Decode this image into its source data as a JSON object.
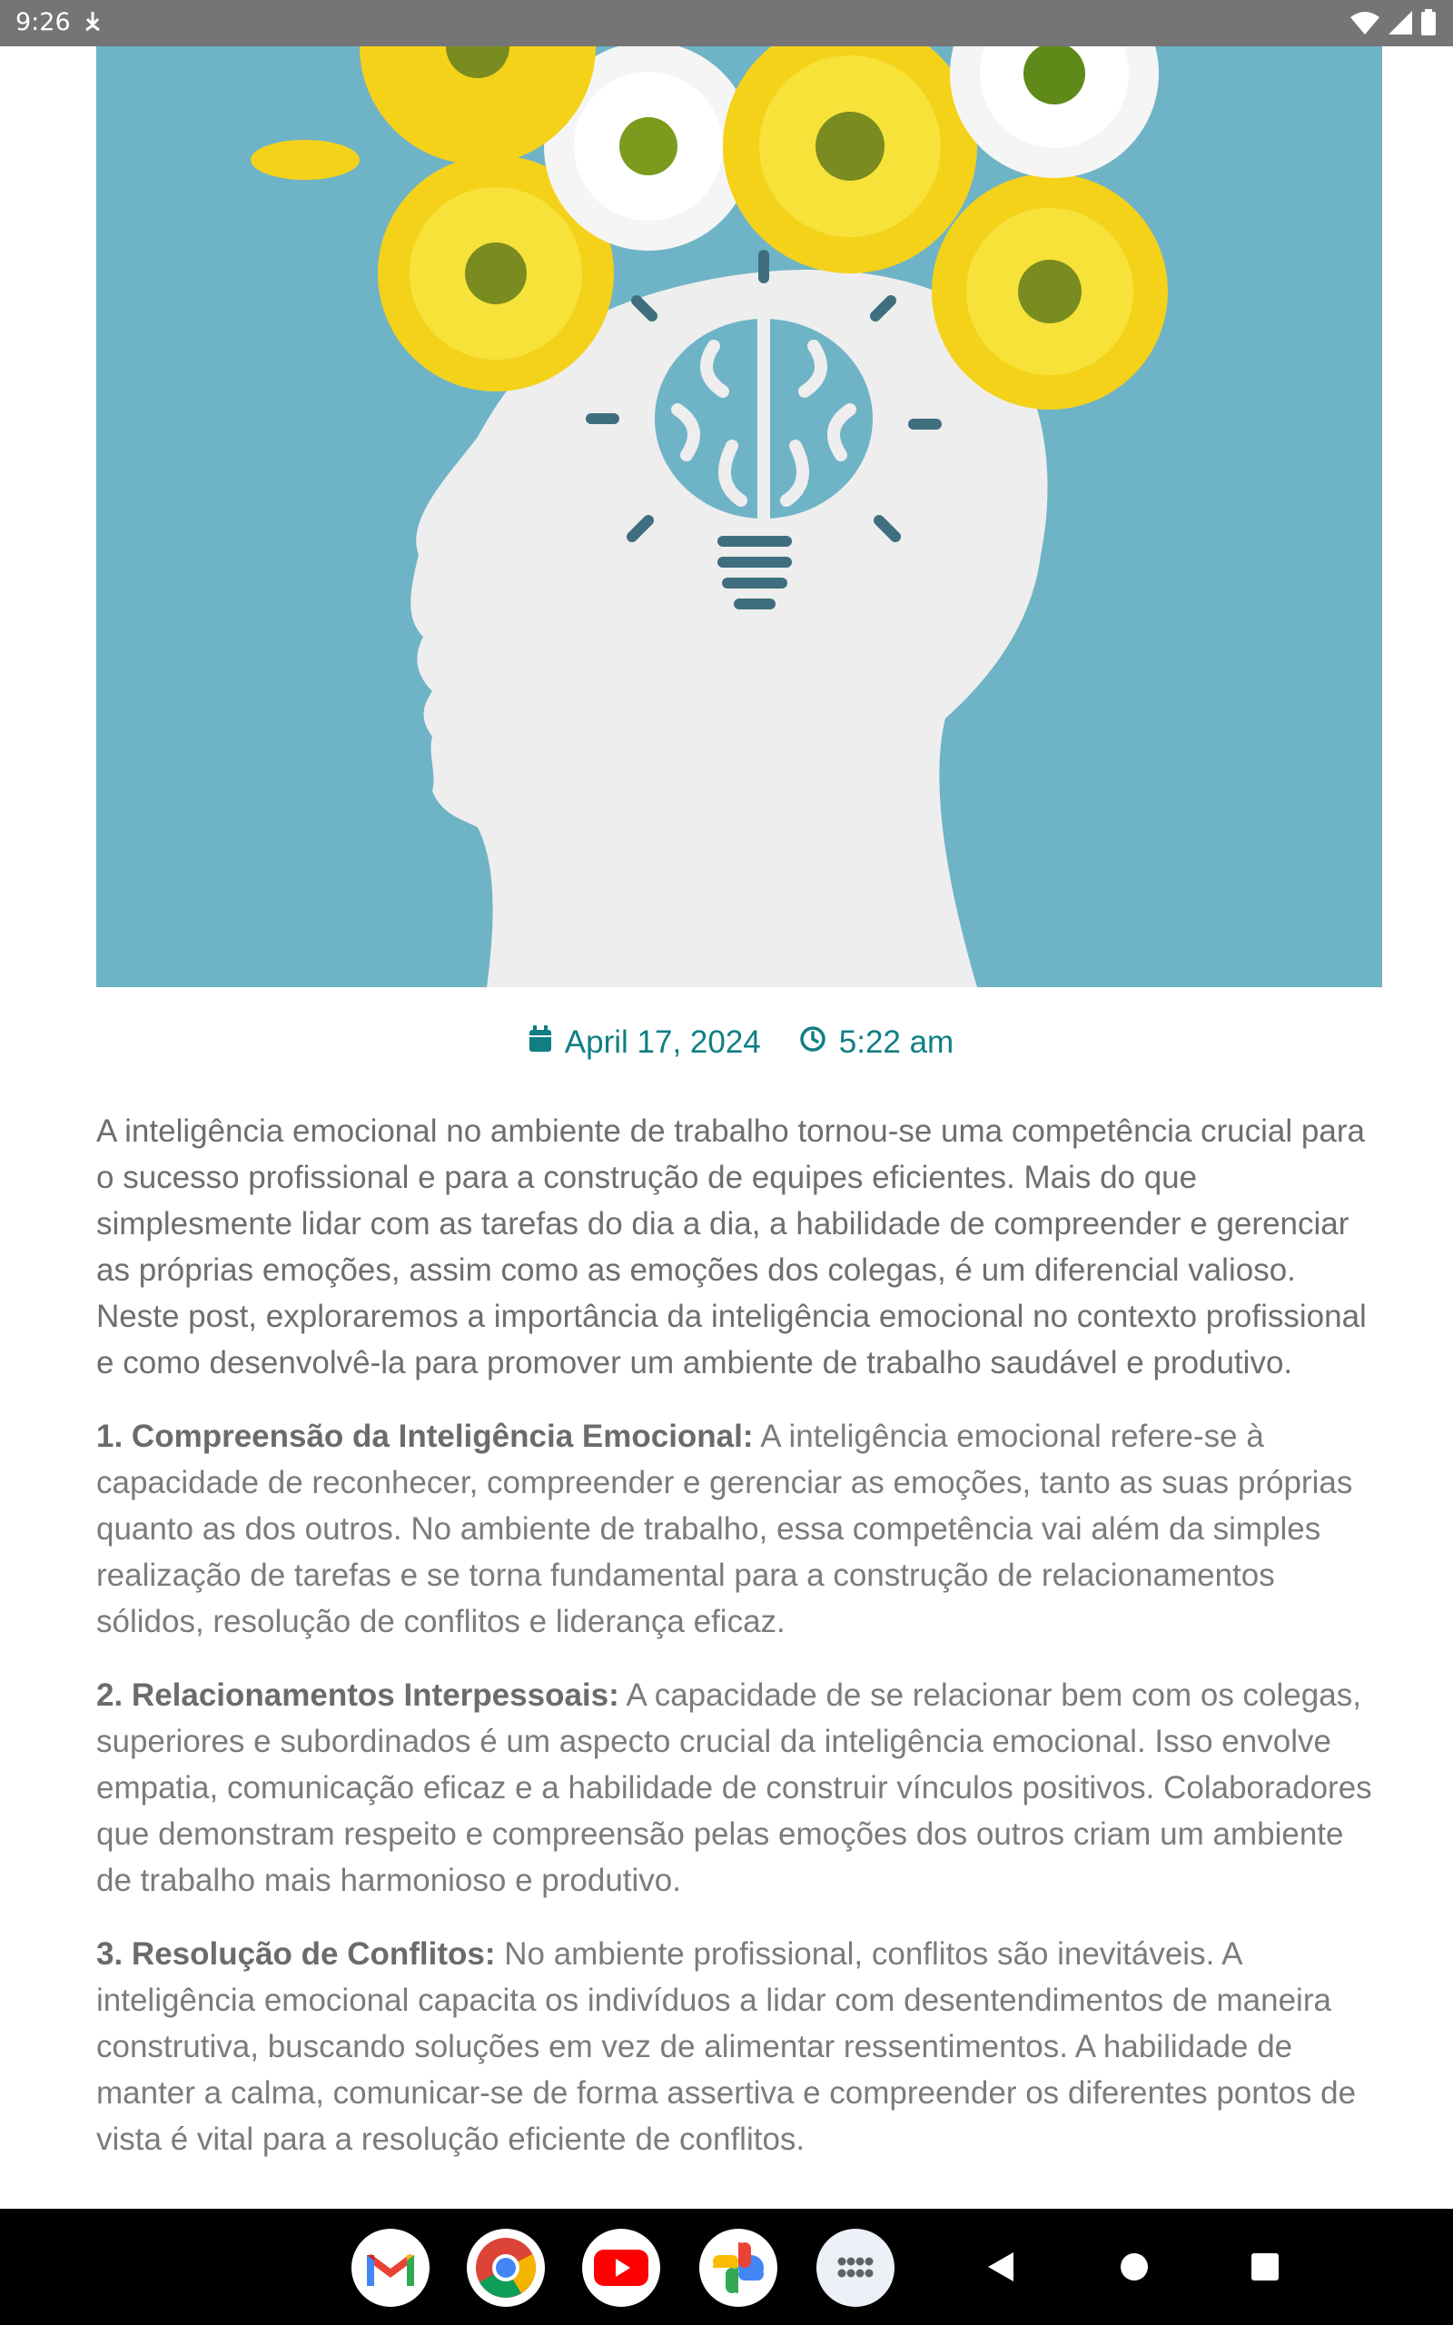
{
  "status_bar": {
    "time": "9:26",
    "icons": [
      "download-icon",
      "wifi-icon",
      "signal-icon",
      "battery-icon"
    ]
  },
  "hero": {
    "image": "head-silhouette-with-flowers-and-brain-lightbulb",
    "background_color": "#6fb3c7"
  },
  "meta": {
    "date": "April 17, 2024",
    "time": "5:22 am",
    "accent_color": "#0f7f84"
  },
  "article": {
    "intro": "A inteligência emocional no ambiente de trabalho tornou-se uma competência crucial para o sucesso profissional e para a construção de equipes eficientes. Mais do que simplesmente lidar com as tarefas do dia a dia, a habilidade de compreender e gerenciar as próprias emoções, assim como as emoções dos colegas, é um diferencial valioso. Neste post, exploraremos a importância da inteligência emocional no contexto profissional e como desenvolvê-la para promover um ambiente de trabalho saudável e produtivo.",
    "sections": [
      {
        "heading": "1. Compreensão da Inteligência Emocional:",
        "text": " A inteligência emocional refere-se à capacidade de reconhecer, compreender e gerenciar as emoções, tanto as suas próprias quanto as dos outros. No ambiente de trabalho, essa competência vai além da simples realização de tarefas e se torna fundamental para a construção de relacionamentos sólidos, resolução de conflitos e liderança eficaz."
      },
      {
        "heading": "2. Relacionamentos Interpessoais:",
        "text": " A capacidade de se relacionar bem com os colegas, superiores e subordinados é um aspecto crucial da inteligência emocional. Isso envolve empatia, comunicação eficaz e a habilidade de construir vínculos positivos. Colaboradores que demonstram respeito e compreensão pelas emoções dos outros criam um ambiente de trabalho mais harmonioso e produtivo."
      },
      {
        "heading": "3. Resolução de Conflitos:",
        "text": " No ambiente profissional, conflitos são inevitáveis. A inteligência emocional capacita os indivíduos a lidar com desentendimentos de maneira construtiva, buscando soluções em vez de alimentar ressentimentos. A habilidade de manter a calma, comunicar-se de forma assertiva e compreender os diferentes pontos de vista é vital para a resolução eficiente de conflitos."
      }
    ]
  },
  "nav_bar": {
    "apps": [
      "gmail-icon",
      "chrome-icon",
      "youtube-icon",
      "photos-icon",
      "app-drawer-icon"
    ],
    "buttons": [
      "back-icon",
      "home-icon",
      "recents-icon"
    ]
  }
}
